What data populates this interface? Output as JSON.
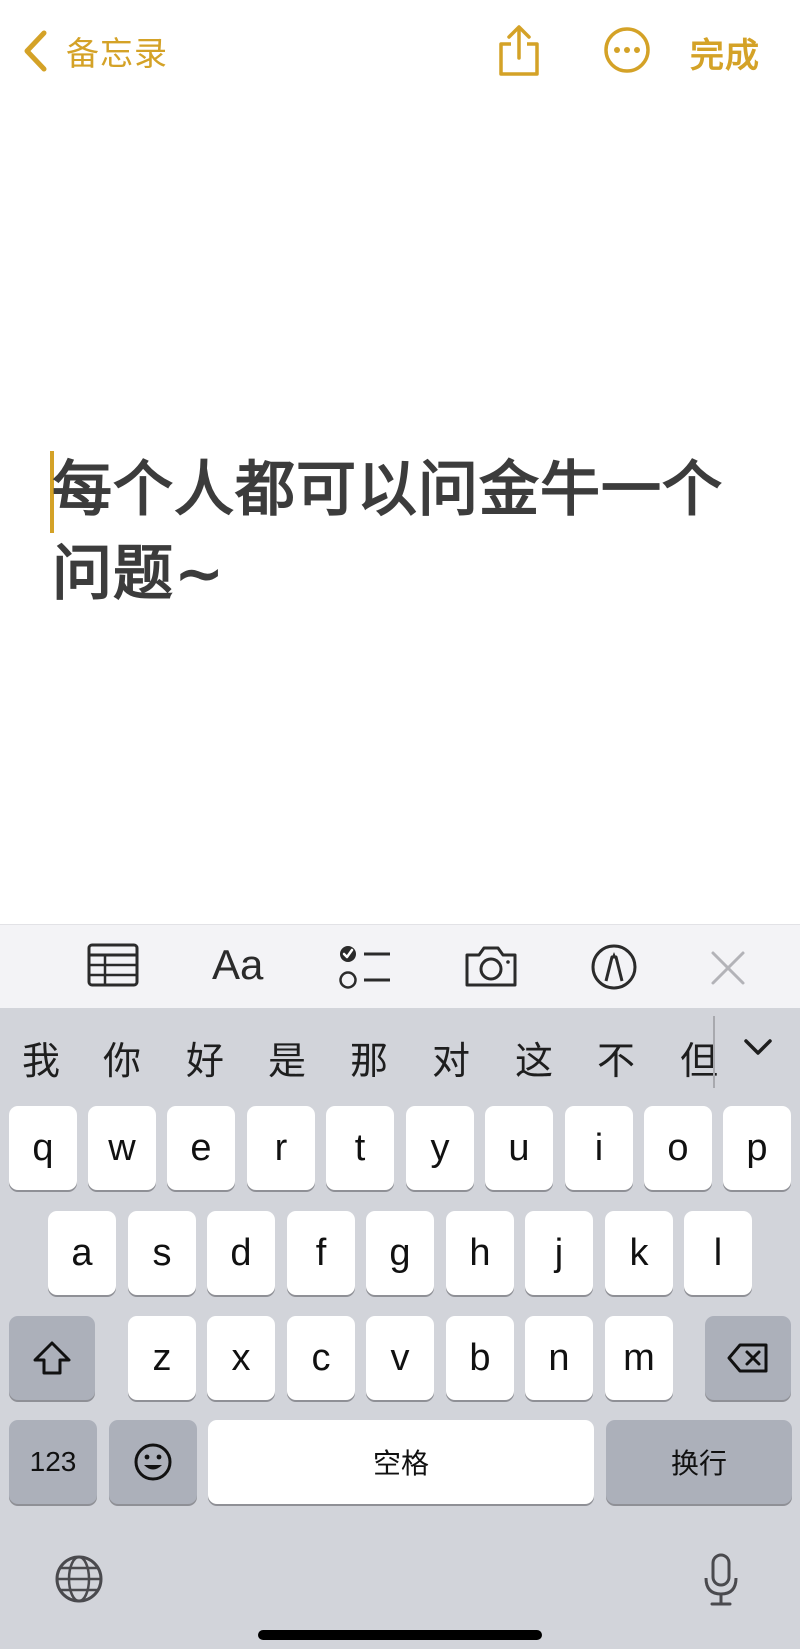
{
  "nav": {
    "back_label": "备忘录",
    "done_label": "完成"
  },
  "note": {
    "line1": "每个人都可以问金牛一个",
    "line2": "问题~"
  },
  "toolbar": {
    "format_label": "Aa",
    "icons": [
      "table-icon",
      "text-format-icon",
      "checklist-icon",
      "camera-icon",
      "markup-icon",
      "close-icon"
    ]
  },
  "keyboard": {
    "candidates": [
      "我",
      "你",
      "好",
      "是",
      "那",
      "对",
      "这",
      "不",
      "但"
    ],
    "row1": [
      "q",
      "w",
      "e",
      "r",
      "t",
      "y",
      "u",
      "i",
      "o",
      "p"
    ],
    "row2": [
      "a",
      "s",
      "d",
      "f",
      "g",
      "h",
      "j",
      "k",
      "l"
    ],
    "row3": [
      "z",
      "x",
      "c",
      "v",
      "b",
      "n",
      "m"
    ],
    "numbers_label": "123",
    "space_label": "空格",
    "return_label": "换行"
  },
  "colors": {
    "accent": "#d4a227",
    "note_text": "#3c3c3c",
    "keyboard_bg": "#d2d4da",
    "toolbar_bg": "#f3f3f6"
  }
}
